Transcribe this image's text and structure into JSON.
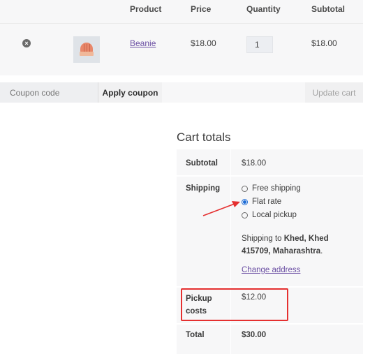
{
  "cart": {
    "headers": {
      "product": "Product",
      "price": "Price",
      "quantity": "Quantity",
      "subtotal": "Subtotal"
    },
    "items": [
      {
        "remove_icon": "×",
        "name": "Beanie",
        "price": "$18.00",
        "quantity": "1",
        "subtotal": "$18.00"
      }
    ]
  },
  "actions": {
    "coupon_placeholder": "Coupon code",
    "apply_label": "Apply coupon",
    "update_label": "Update cart"
  },
  "totals": {
    "title": "Cart totals",
    "subtotal_label": "Subtotal",
    "subtotal_value": "$18.00",
    "shipping_label": "Shipping",
    "shipping_options": [
      {
        "label": "Free shipping",
        "selected": false
      },
      {
        "label": "Flat rate",
        "selected": true
      },
      {
        "label": "Local pickup",
        "selected": false
      }
    ],
    "shipping_to_prefix": "Shipping to ",
    "shipping_destination": "Khed, Khed 415709, Maharashtra",
    "shipping_to_suffix": ".",
    "change_address": "Change address",
    "pickup_label_line1": "Pickup",
    "pickup_label_line2": "costs",
    "pickup_value": "$12.00",
    "total_label": "Total",
    "total_value": "$30.00"
  },
  "annotation": {
    "highlight_color": "#e53030"
  }
}
